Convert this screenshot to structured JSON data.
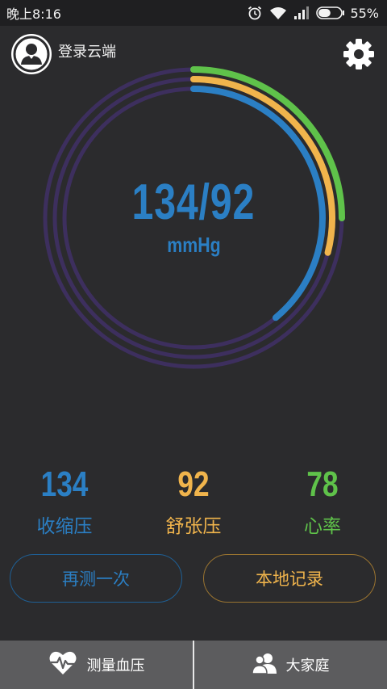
{
  "status_bar": {
    "time": "晚上8:16",
    "battery_percent": "55%",
    "battery_level": 0.55,
    "icons": [
      "alarm-icon",
      "wifi-icon",
      "signal-icon",
      "battery-icon"
    ]
  },
  "header": {
    "cloud_login": "登录云端",
    "avatar_icon": "user-avatar-icon",
    "settings_icon": "gear-icon"
  },
  "gauge": {
    "reading": "134/92",
    "unit": "mmHg",
    "rings": [
      {
        "name": "heart-rate-ring",
        "color": "#5fc24a",
        "fraction": 0.25
      },
      {
        "name": "diastolic-ring",
        "color": "#f0b44c",
        "fraction": 0.29
      },
      {
        "name": "systolic-ring",
        "color": "#2b7fc4",
        "fraction": 0.39
      }
    ],
    "track_color": "#3d2f5e"
  },
  "stats": {
    "systolic": {
      "value": "134",
      "label": "收缩压"
    },
    "diastolic": {
      "value": "92",
      "label": "舒张压"
    },
    "heart_rate": {
      "value": "78",
      "label": "心率"
    }
  },
  "buttons": {
    "measure_again": "再测一次",
    "local_records": "本地记录"
  },
  "bottom_nav": {
    "measure": {
      "label": "测量血压",
      "icon": "heart-pulse-icon"
    },
    "family": {
      "label": "大家庭",
      "icon": "family-icon"
    }
  },
  "colors": {
    "blue": "#2b7fc4",
    "yellow": "#f0b44c",
    "green": "#5fc24a",
    "background": "#2b2b2d"
  }
}
